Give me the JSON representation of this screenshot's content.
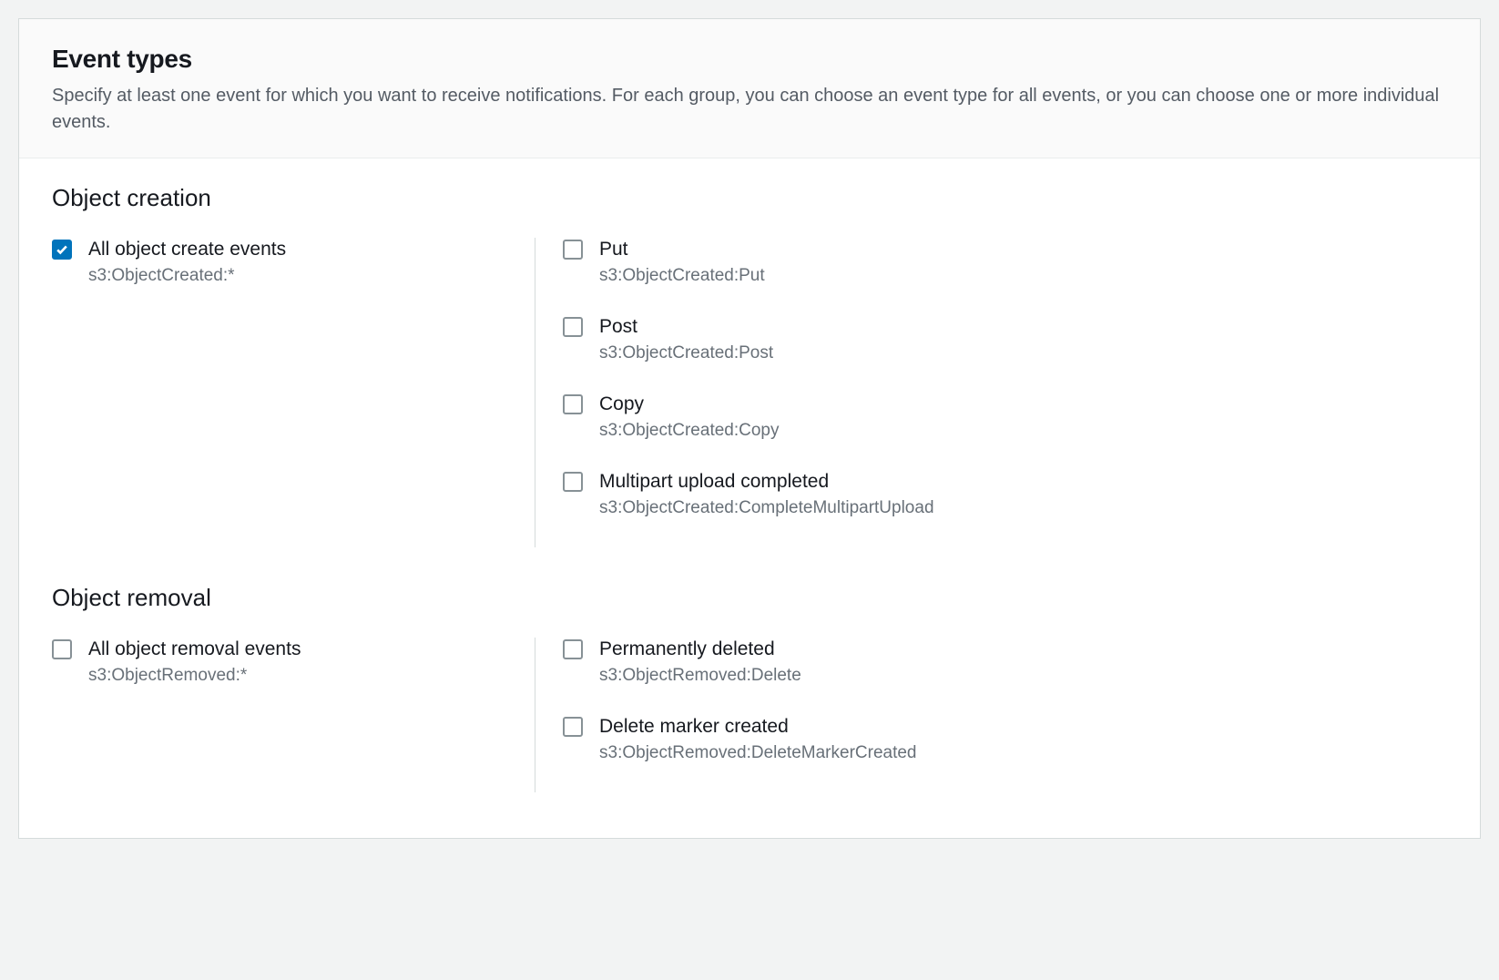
{
  "header": {
    "title": "Event types",
    "description": "Specify at least one event for which you want to receive notifications. For each group, you can choose an event type for all events, or you can choose one or more individual events."
  },
  "sections": [
    {
      "title": "Object creation",
      "all": {
        "label": "All object create events",
        "sub": "s3:ObjectCreated:*",
        "checked": true
      },
      "items": [
        {
          "label": "Put",
          "sub": "s3:ObjectCreated:Put",
          "checked": false
        },
        {
          "label": "Post",
          "sub": "s3:ObjectCreated:Post",
          "checked": false
        },
        {
          "label": "Copy",
          "sub": "s3:ObjectCreated:Copy",
          "checked": false
        },
        {
          "label": "Multipart upload completed",
          "sub": "s3:ObjectCreated:CompleteMultipartUpload",
          "checked": false
        }
      ]
    },
    {
      "title": "Object removal",
      "all": {
        "label": "All object removal events",
        "sub": "s3:ObjectRemoved:*",
        "checked": false
      },
      "items": [
        {
          "label": "Permanently deleted",
          "sub": "s3:ObjectRemoved:Delete",
          "checked": false
        },
        {
          "label": "Delete marker created",
          "sub": "s3:ObjectRemoved:DeleteMarkerCreated",
          "checked": false
        }
      ]
    }
  ]
}
